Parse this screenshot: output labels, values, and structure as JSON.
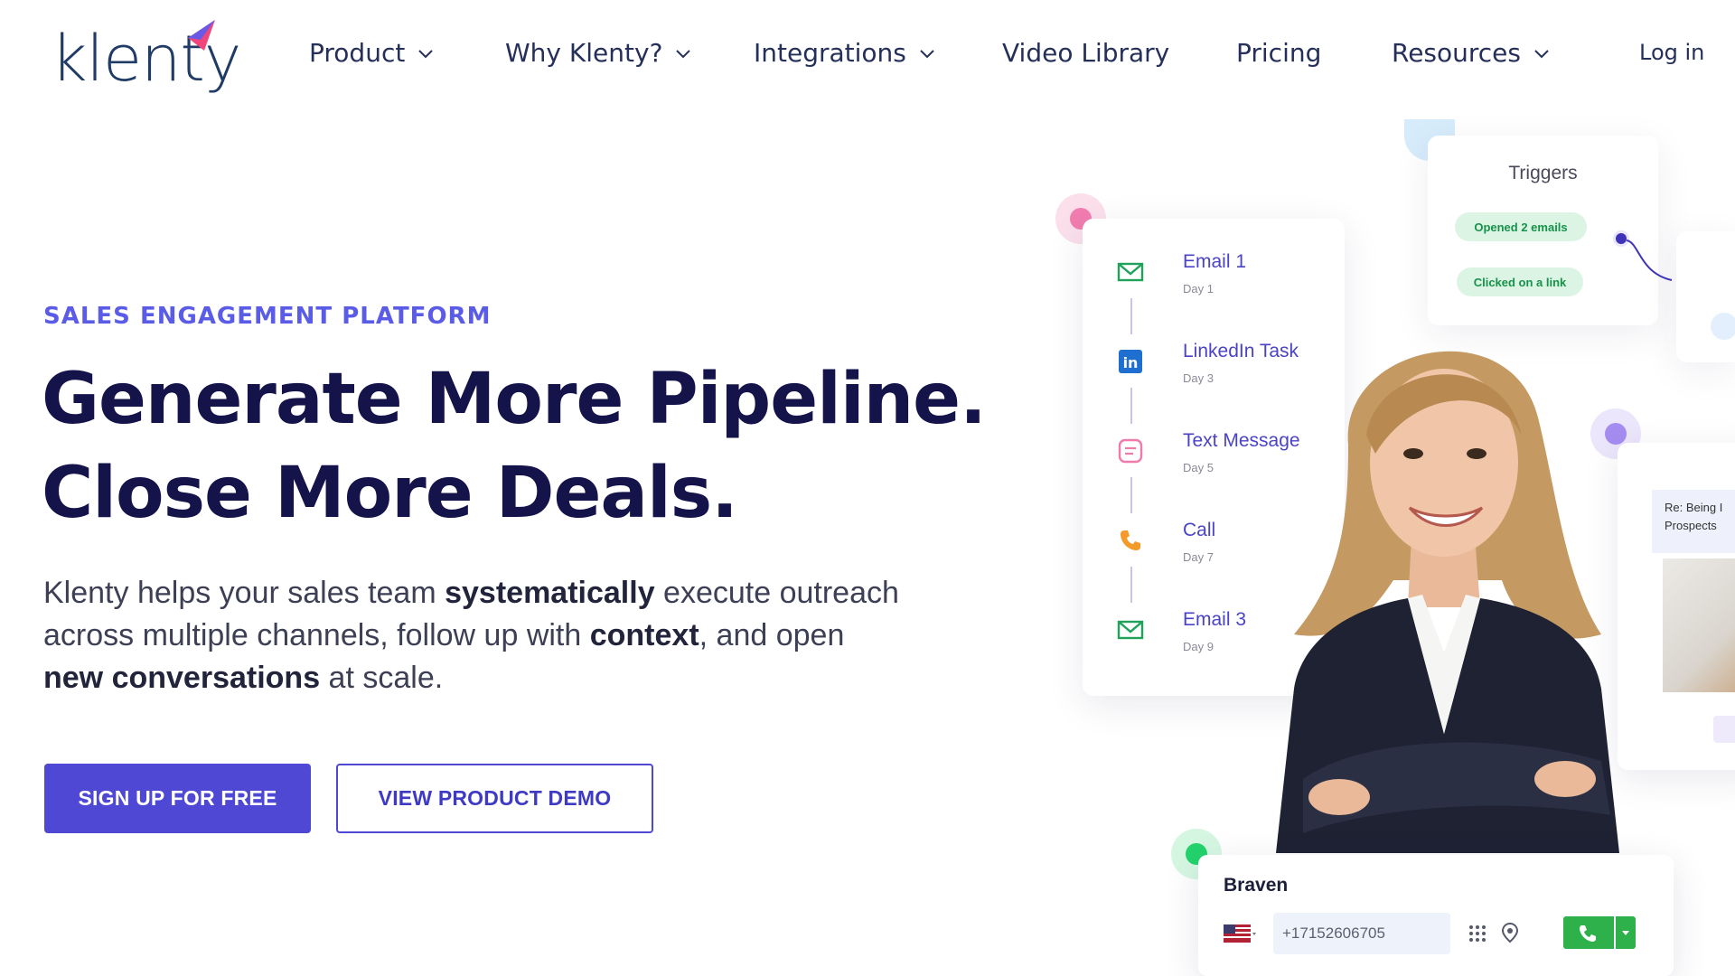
{
  "logo": {
    "text": "klenty"
  },
  "nav": {
    "items": [
      {
        "label": "Product",
        "has_dropdown": true
      },
      {
        "label": "Why Klenty?",
        "has_dropdown": true
      },
      {
        "label": "Integrations",
        "has_dropdown": true
      },
      {
        "label": "Video Library",
        "has_dropdown": false
      },
      {
        "label": "Pricing",
        "has_dropdown": false
      },
      {
        "label": "Resources",
        "has_dropdown": true
      }
    ],
    "login_label": "Log in"
  },
  "hero": {
    "eyebrow": "SALES ENGAGEMENT PLATFORM",
    "headline_line1": "Generate More Pipeline.",
    "headline_line2": "Close More Deals.",
    "sub": {
      "p1": "Klenty helps your sales team ",
      "b1": "systematically",
      "p2": " execute outreach across multiple channels, follow up with ",
      "b2": "context",
      "p3": ", and open ",
      "b3": "new conversations",
      "p4": " at scale."
    },
    "cta_primary": "SIGN UP FOR FREE",
    "cta_secondary": "VIEW PRODUCT DEMO"
  },
  "sequence": {
    "steps": [
      {
        "title": "Email 1",
        "day": "Day 1",
        "icon": "mail-icon"
      },
      {
        "title": "LinkedIn Task",
        "day": "Day 3",
        "icon": "linkedin-icon"
      },
      {
        "title": "Text Message",
        "day": "Day 5",
        "icon": "message-icon"
      },
      {
        "title": "Call",
        "day": "Day 7",
        "icon": "phone-icon"
      },
      {
        "title": "Email 3",
        "day": "Day 9",
        "icon": "mail-icon"
      }
    ]
  },
  "triggers": {
    "title": "Triggers",
    "pills": [
      "Opened 2 emails",
      "Clicked on a link"
    ]
  },
  "side_email": {
    "line1": "Re: Being I",
    "line2": "Prospects"
  },
  "caller": {
    "name": "Braven",
    "phone": "+17152606705"
  },
  "colors": {
    "brand": "#4e48d4",
    "headline": "#14134a",
    "eyebrow": "#5a5ce8",
    "call_green": "#2eb04a",
    "pill_bg": "#dcf4e4"
  }
}
